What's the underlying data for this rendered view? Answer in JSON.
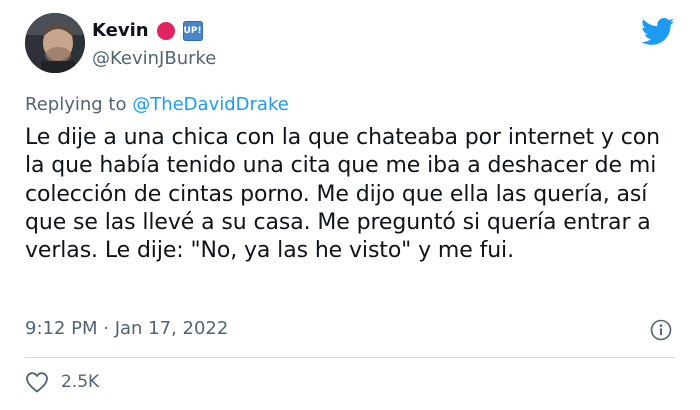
{
  "author": {
    "display_name": "Kevin",
    "handle": "@KevinJBurke",
    "badge_text": "UP!"
  },
  "reply": {
    "prefix": "Replying to ",
    "mention": "@TheDavidDrake"
  },
  "tweet": {
    "text": "Le dije a una chica con la que chateaba por internet y con la que había tenido una cita que me iba a deshacer de mi colección de cintas porno. Me dijo que ella las quería, así que se las llevé a su casa.  Me preguntó si quería entrar a verlas. Le dije: \"No, ya las he visto\" y me fui.",
    "timestamp": "9:12 PM · Jan 17, 2022",
    "likes": "2.5K"
  },
  "colors": {
    "accent": "#1d9bf0",
    "red_dot": "#e0245e",
    "muted": "#536471",
    "divider": "#cfd9de"
  },
  "icons": {
    "brand": "twitter-bird-icon",
    "info": "info-icon",
    "like": "heart-icon"
  }
}
